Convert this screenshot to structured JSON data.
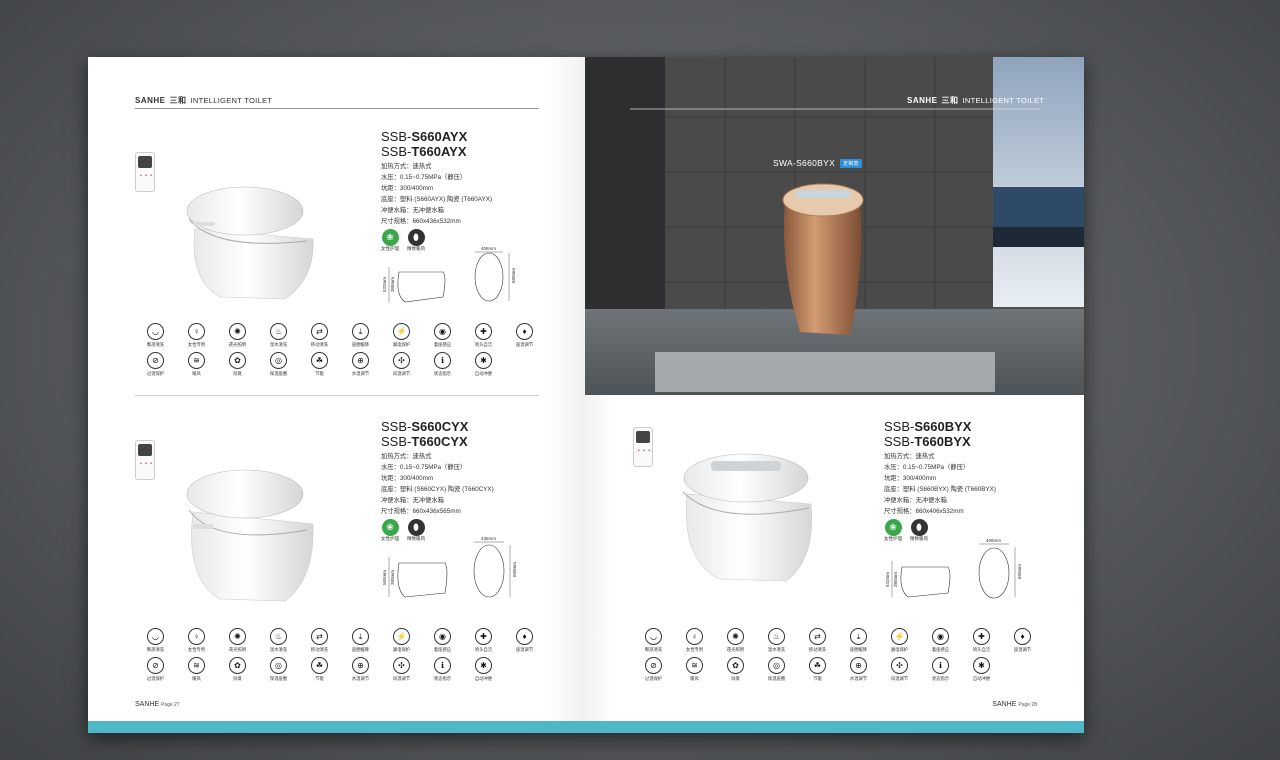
{
  "brand": "SANHE",
  "brand_cn": "三和",
  "subtitle": "INTELLIGENT TOILET",
  "left_page": {
    "footer": {
      "brand": "SANHE",
      "page": "Page 27"
    },
    "products": [
      {
        "model_line1_prefix": "SSB-",
        "model_line1_bold": "S660AYX",
        "model_line2_prefix": "SSB-",
        "model_line2_bold": "T660AYX",
        "specs": [
          "加热方式：速热式",
          "水压：0.15~0.75MPa（静压）",
          "坑距：300/400mm",
          "底座：塑料 (S660AYX) 陶瓷 (T660AYX)",
          "冲便水箱：无冲便水箱",
          "尺寸规格：660x436x532mm"
        ],
        "certs": [
          "女性护理",
          "精致暖风"
        ],
        "dims": {
          "width": "406mm",
          "height_total": "532mm",
          "height_seat": "380mm",
          "length": "660mm"
        }
      },
      {
        "model_line1_prefix": "SSB-",
        "model_line1_bold": "S660CYX",
        "model_line2_prefix": "SSB-",
        "model_line2_bold": "T660CYX",
        "specs": [
          "加热方式：速热式",
          "水压：0.15~0.75MPa（静压）",
          "坑距：300/400mm",
          "底座：塑料 (S660CYX) 陶瓷 (T660CYX)",
          "冲便水箱：无冲便水箱",
          "尺寸规格：660x436x565mm"
        ],
        "certs": [
          "女性护理",
          "精致暖风"
        ],
        "dims": {
          "width": "436mm",
          "height_total": "565mm",
          "height_seat": "380mm",
          "length": "660mm"
        }
      }
    ]
  },
  "right_page": {
    "footer": {
      "brand": "SANHE",
      "page": "Page 28"
    },
    "photo": {
      "title": "SWA-S660BYX",
      "badge": "定制款",
      "accent": "#b87a55"
    },
    "products": [
      {
        "model_line1_prefix": "SSB-",
        "model_line1_bold": "S660BYX",
        "model_line2_prefix": "SSB-",
        "model_line2_bold": "T660BYX",
        "specs": [
          "加热方式：速热式",
          "水压：0.15~0.75MPa（静压）",
          "坑距：300/400mm",
          "底座：塑料 (S660BYX) 陶瓷 (T660BYX)",
          "冲便水箱：无冲便水箱",
          "尺寸规格：660x406x532mm"
        ],
        "certs": [
          "女性护理",
          "精致暖风"
        ],
        "dims": {
          "width": "406mm",
          "height_total": "532mm",
          "height_seat": "380mm",
          "length": "660mm"
        }
      }
    ]
  },
  "features": [
    {
      "label": "臀部清洗",
      "icon": "butt-wash-icon",
      "glyph": "◡"
    },
    {
      "label": "女性专用",
      "icon": "female-wash-icon",
      "glyph": "♀"
    },
    {
      "label": "夜光照明",
      "icon": "night-light-icon",
      "glyph": "✺"
    },
    {
      "label": "温水清洗",
      "icon": "warm-water-icon",
      "glyph": "♨"
    },
    {
      "label": "移动清洗",
      "icon": "moving-wash-icon",
      "glyph": "⇄"
    },
    {
      "label": "座圈缓降",
      "icon": "slow-close-icon",
      "glyph": "⤓"
    },
    {
      "label": "漏电保护",
      "icon": "leakage-protection-icon",
      "glyph": "⚡"
    },
    {
      "label": "着座感应",
      "icon": "seat-sensor-icon",
      "glyph": "◉"
    },
    {
      "label": "喷头自洁",
      "icon": "nozzle-clean-icon",
      "glyph": "✚"
    },
    {
      "label": "座温调节",
      "icon": "seat-temp-icon",
      "glyph": "♦"
    },
    {
      "label": "过温保护",
      "icon": "over-temp-icon",
      "glyph": "⊘"
    },
    {
      "label": "暖风",
      "icon": "warm-air-icon",
      "glyph": "≋"
    },
    {
      "label": "除臭",
      "icon": "deodorize-icon",
      "glyph": "✿"
    },
    {
      "label": "保温座圈",
      "icon": "heated-seat-icon",
      "glyph": "◎"
    },
    {
      "label": "节能",
      "icon": "energy-save-icon",
      "glyph": "☘"
    },
    {
      "label": "水温调节",
      "icon": "water-temp-icon",
      "glyph": "⊕"
    },
    {
      "label": "风温调节",
      "icon": "air-temp-icon",
      "glyph": "✣"
    },
    {
      "label": "状态指示",
      "icon": "status-indicator-icon",
      "glyph": "ℹ"
    },
    {
      "label": "自动冲便",
      "icon": "auto-flush-icon",
      "glyph": "✱"
    }
  ],
  "colors": {
    "band": "#4fb8c8",
    "cert_green": "#3aa84a",
    "cert_dark": "#333333",
    "badge": "#2f8fd6"
  }
}
